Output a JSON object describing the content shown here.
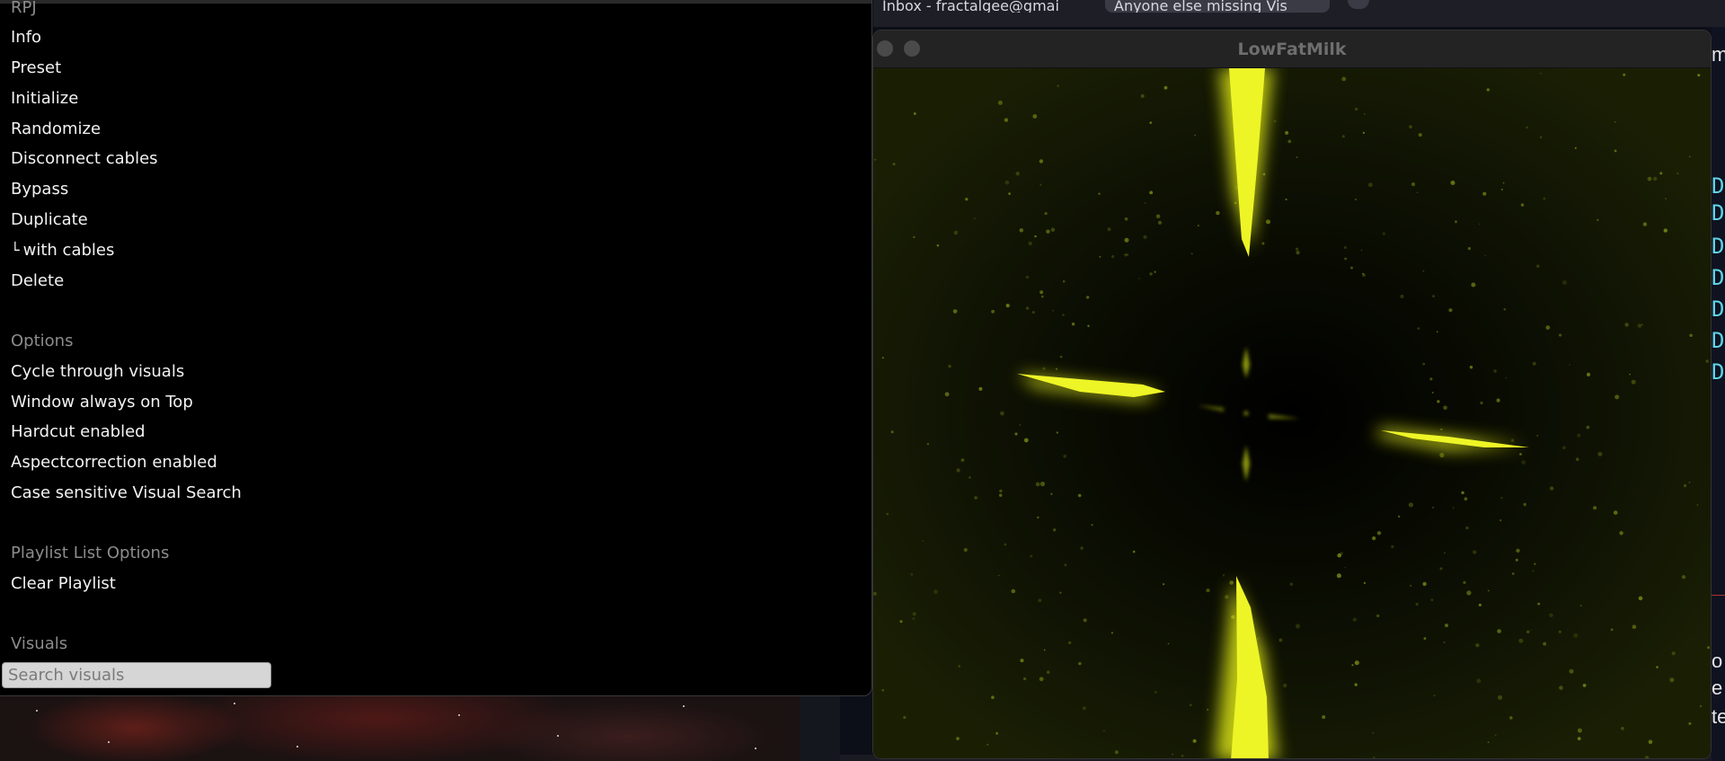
{
  "menu": {
    "items": [
      {
        "label": "RPJ",
        "kind": "header-clipped"
      },
      {
        "label": "Info",
        "kind": "item"
      },
      {
        "label": "Preset",
        "kind": "item"
      },
      {
        "label": "Initialize",
        "kind": "item"
      },
      {
        "label": "Randomize",
        "kind": "item"
      },
      {
        "label": "Disconnect cables",
        "kind": "item"
      },
      {
        "label": "Bypass",
        "kind": "item"
      },
      {
        "label": "Duplicate",
        "kind": "item"
      },
      {
        "label": "with cables",
        "kind": "subitem",
        "glyph": "└"
      },
      {
        "label": "Delete",
        "kind": "item"
      }
    ],
    "options_header": "Options",
    "options": [
      "Cycle through visuals",
      "Window always on Top",
      "Hardcut enabled",
      "Aspectcorrection enabled",
      "Case sensitive Visual Search"
    ],
    "playlist_header": "Playlist List Options",
    "playlist_items": [
      "Clear Playlist"
    ],
    "visuals_header": "Visuals",
    "search_placeholder": "Search visuals"
  },
  "visualizer": {
    "title": "LowFatMilk",
    "accent_color": "#e8f21a"
  },
  "background": {
    "browser_tabs": [
      "Inbox - fractalgee@gmai",
      "Anyone else missing Vis"
    ],
    "right_fragments": [
      "Dc",
      "Dc",
      "Dc",
      "Dc",
      "Dc",
      "Dc",
      "Dc",
      "o",
      "e",
      "te"
    ]
  }
}
